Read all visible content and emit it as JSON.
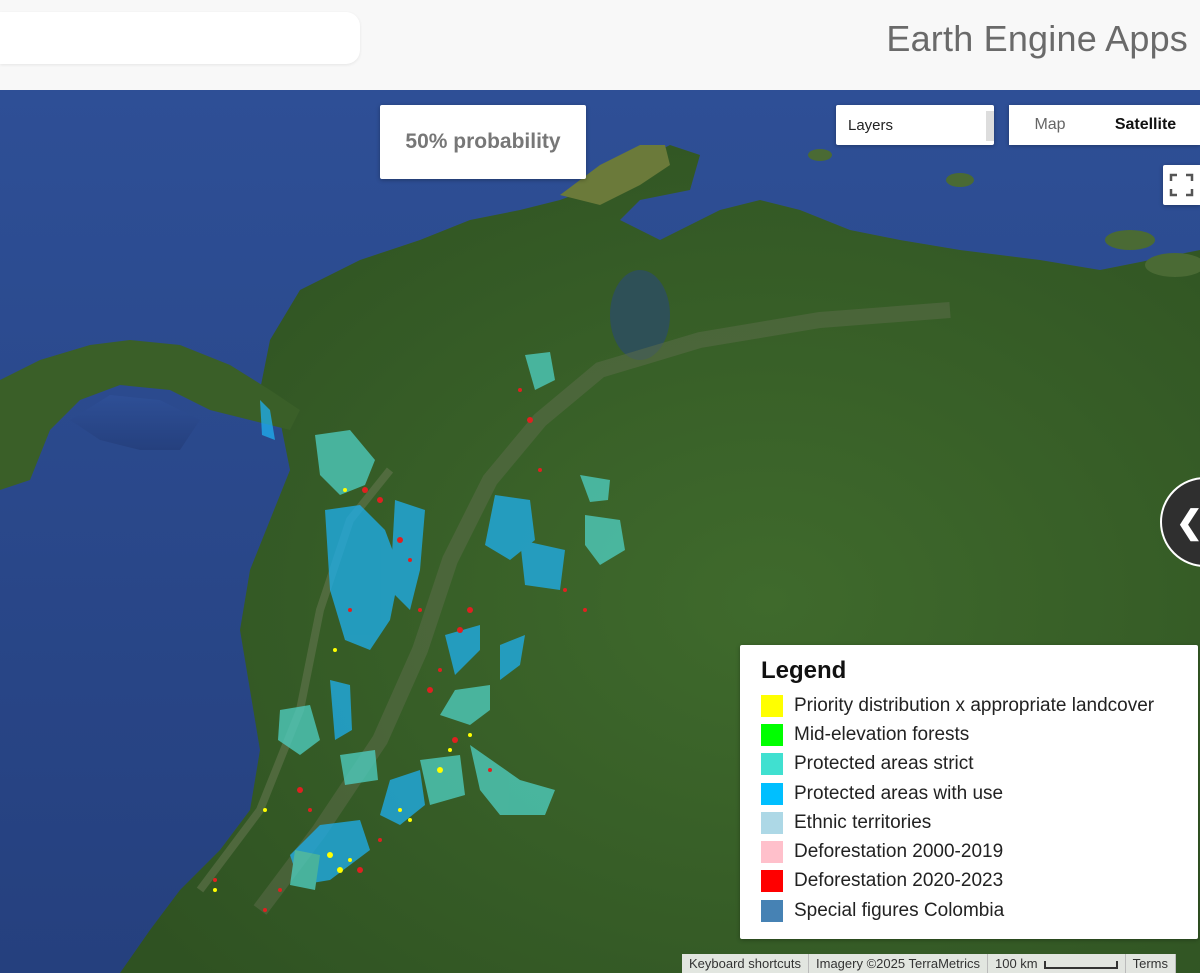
{
  "header": {
    "app_title": "Earth Engine Apps",
    "search_placeholder": ""
  },
  "map": {
    "probability_label": "50% probability",
    "layers_select": {
      "selected": "Layers"
    },
    "map_type": {
      "options": [
        "Map",
        "Satellite"
      ],
      "selected": "Satellite"
    },
    "icons": {
      "fullscreen": "fullscreen-icon",
      "collapse": "chevron-left-icon"
    },
    "colors": {
      "ocean": "#2b4a8f",
      "land": "#3d5c2a",
      "protected_strict": "#4fd1c5",
      "protected_use": "#1eb0f0",
      "priority": "#ffff00",
      "deforestation_recent": "#e02020"
    }
  },
  "legend": {
    "title": "Legend",
    "items": [
      {
        "label": "Priority distribution x appropriate landcover",
        "color": "#ffff00"
      },
      {
        "label": "Mid-elevation forests",
        "color": "#00ff00"
      },
      {
        "label": "Protected areas strict",
        "color": "#40e0d0"
      },
      {
        "label": "Protected areas with use",
        "color": "#00bfff"
      },
      {
        "label": "Ethnic territories",
        "color": "#add8e6"
      },
      {
        "label": "Deforestation 2000-2019",
        "color": "#ffc0cb"
      },
      {
        "label": "Deforestation 2020-2023",
        "color": "#ff0000"
      },
      {
        "label": "Special figures Colombia",
        "color": "#4682b4"
      }
    ]
  },
  "attribution": {
    "shortcuts": "Keyboard shortcuts",
    "imagery": "Imagery ©2025 TerraMetrics",
    "scale": "100 km",
    "terms": "Terms"
  }
}
